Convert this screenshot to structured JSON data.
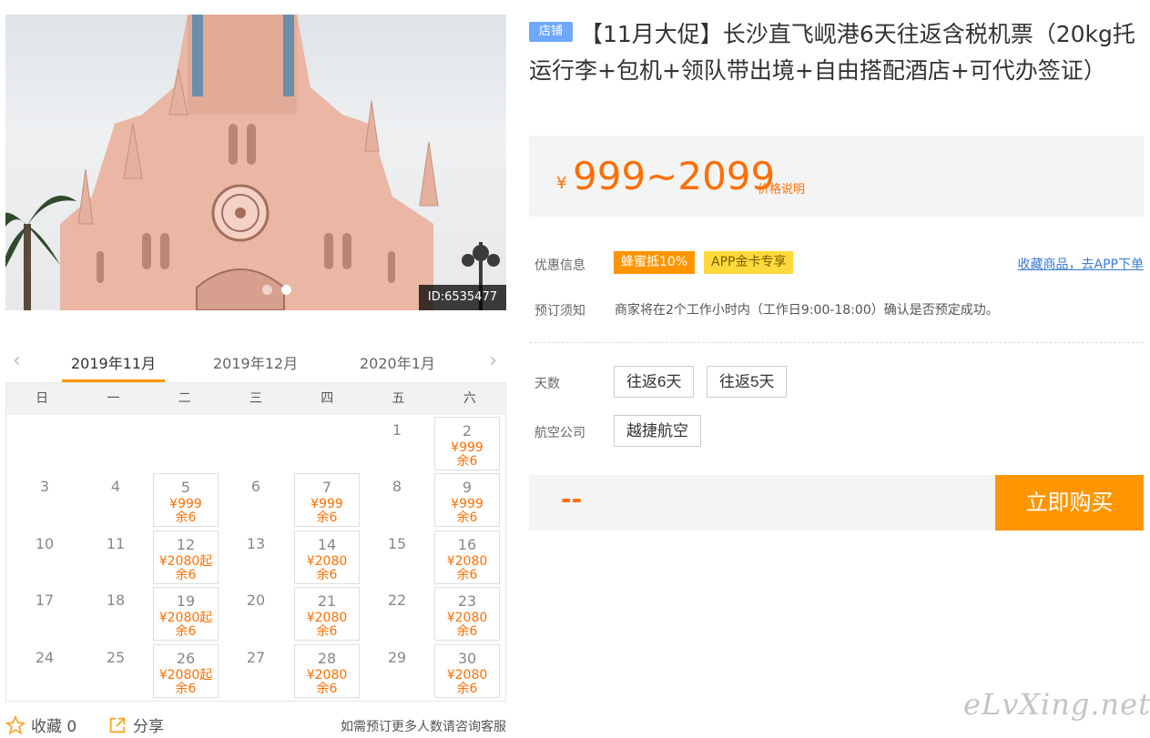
{
  "gallery": {
    "image_id": "ID:6535477",
    "dots": 2,
    "active_dot": 2
  },
  "calendar": {
    "prev_arrow": "‹",
    "next_arrow": "›",
    "months": [
      "2019年11月",
      "2019年12月",
      "2020年1月"
    ],
    "weekdays": [
      "日",
      "一",
      "二",
      "三",
      "四",
      "五",
      "六"
    ],
    "days": [
      {
        "d": "1"
      },
      {
        "d": "2",
        "price": "¥999",
        "stock": "余6"
      },
      {
        "d": "3"
      },
      {
        "d": "4"
      },
      {
        "d": "5",
        "price": "¥999",
        "stock": "余6"
      },
      {
        "d": "6"
      },
      {
        "d": "7",
        "price": "¥999",
        "stock": "余6"
      },
      {
        "d": "8"
      },
      {
        "d": "9",
        "price": "¥999",
        "stock": "余6"
      },
      {
        "d": "10"
      },
      {
        "d": "11"
      },
      {
        "d": "12",
        "price": "¥2080起",
        "stock": "余6"
      },
      {
        "d": "13"
      },
      {
        "d": "14",
        "price": "¥2080",
        "stock": "余6"
      },
      {
        "d": "15"
      },
      {
        "d": "16",
        "price": "¥2080",
        "stock": "余6"
      },
      {
        "d": "17"
      },
      {
        "d": "18"
      },
      {
        "d": "19",
        "price": "¥2080起",
        "stock": "余6"
      },
      {
        "d": "20"
      },
      {
        "d": "21",
        "price": "¥2080",
        "stock": "余6"
      },
      {
        "d": "22"
      },
      {
        "d": "23",
        "price": "¥2080",
        "stock": "余6"
      },
      {
        "d": "24"
      },
      {
        "d": "25"
      },
      {
        "d": "26",
        "price": "¥2080起",
        "stock": "余6"
      },
      {
        "d": "27"
      },
      {
        "d": "28",
        "price": "¥2080",
        "stock": "余6"
      },
      {
        "d": "29"
      },
      {
        "d": "30",
        "price": "¥2080",
        "stock": "余6"
      }
    ]
  },
  "actions": {
    "favorite": "收藏 0",
    "share": "分享",
    "consult": "如需预订更多人数请咨询客服"
  },
  "product": {
    "shop_badge": "店铺",
    "title": "【11月大促】长沙直飞岘港6天往返含税机票（20kg托运行李+包机+领队带出境+自由搭配酒店+可代办签证）"
  },
  "price": {
    "currency": "¥",
    "range": "999~2099",
    "explain": "价格说明"
  },
  "promo": {
    "label": "优惠信息",
    "tag1": "蜂蜜抵10%",
    "tag2": "APP金卡专享",
    "app_link": "收藏商品，去APP下单"
  },
  "booking": {
    "label": "预订须知",
    "text": "商家将在2个工作小时内（工作日9:00-18:00）确认是否预定成功。"
  },
  "days_option": {
    "label": "天数",
    "options": [
      "往返6天",
      "往返5天"
    ]
  },
  "airline": {
    "label": "航空公司",
    "options": [
      "越捷航空"
    ]
  },
  "buy": {
    "price_placeholder": "--",
    "button": "立即购买"
  },
  "watermark": "eLvXing.net",
  "colors": {
    "accent": "#ff9500",
    "price": "#ff6e00",
    "link": "#3a7bd5",
    "badge": "#6ea8ff"
  }
}
